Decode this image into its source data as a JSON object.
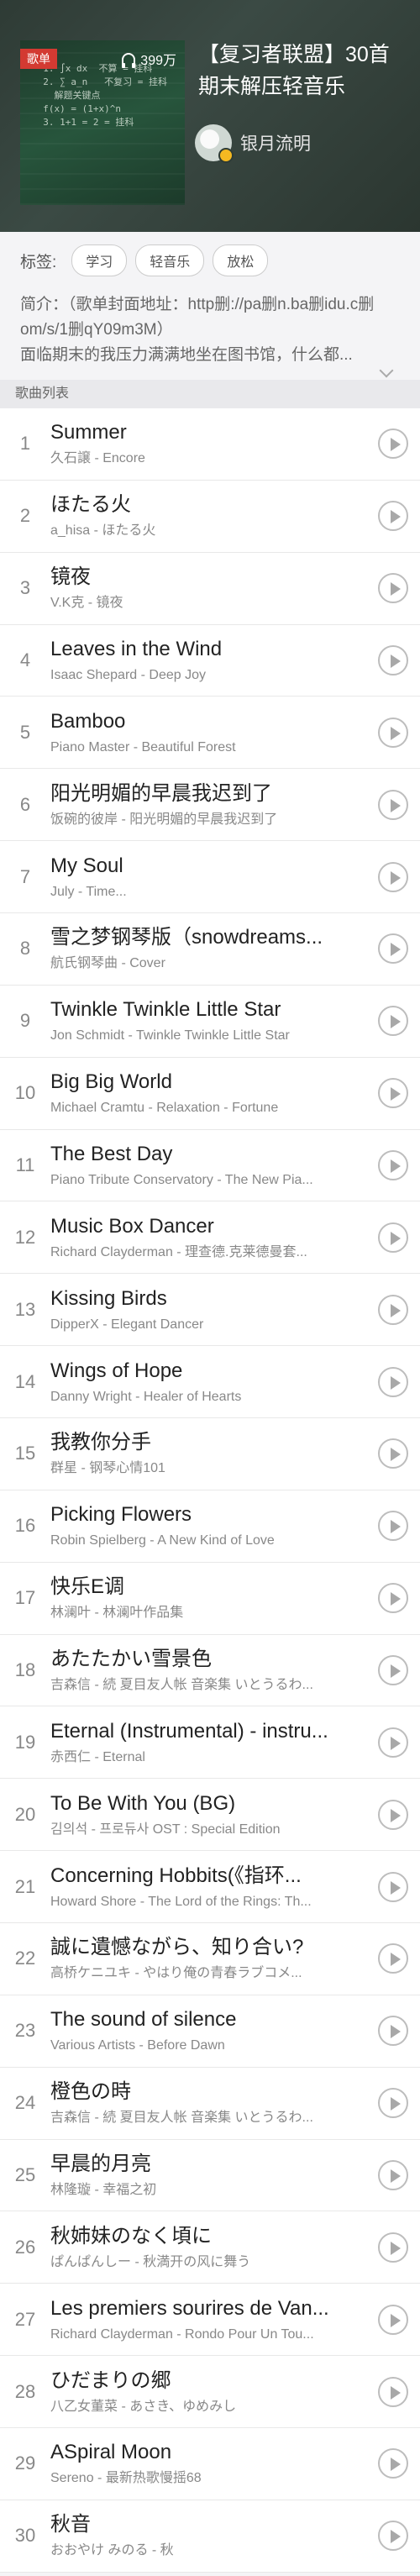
{
  "header": {
    "title": "【复习者联盟】30首期末解压轻音乐",
    "cover_tag": "歌单",
    "play_count": "399万",
    "creator_name": "银月流明"
  },
  "tags": {
    "label": "标签:",
    "items": [
      "学习",
      "轻音乐",
      "放松"
    ]
  },
  "description": {
    "line1": "简介：（歌单封面地址：http删://pa删n.ba删idu.c删om/s/1删qY09m3M）",
    "line2": "面临期末的我压力满满地坐在图书馆，什么都..."
  },
  "list_header": "歌曲列表",
  "songs": [
    {
      "index": "1",
      "name": "Summer",
      "sub": "久石譲 - Encore"
    },
    {
      "index": "2",
      "name": "ほたる火",
      "sub": "a_hisa - ほたる火"
    },
    {
      "index": "3",
      "name": "镜夜",
      "sub": "V.K克 - 镜夜"
    },
    {
      "index": "4",
      "name": "Leaves in the Wind",
      "sub": "Isaac Shepard - Deep Joy"
    },
    {
      "index": "5",
      "name": "Bamboo",
      "sub": "Piano Master - Beautiful Forest"
    },
    {
      "index": "6",
      "name": "阳光明媚的早晨我迟到了",
      "sub": "饭碗的彼岸 - 阳光明媚的早晨我迟到了"
    },
    {
      "index": "7",
      "name": "My Soul",
      "sub": "July - Time..."
    },
    {
      "index": "8",
      "name": "雪之梦钢琴版（snowdreams...",
      "sub": "航氏钢琴曲 - Cover"
    },
    {
      "index": "9",
      "name": "Twinkle Twinkle Little Star",
      "sub": "Jon Schmidt - Twinkle Twinkle Little Star"
    },
    {
      "index": "10",
      "name": "Big Big World",
      "sub": "Michael Cramtu - Relaxation - Fortune"
    },
    {
      "index": "11",
      "name": "The Best Day",
      "sub": "Piano Tribute Conservatory - The New Pia..."
    },
    {
      "index": "12",
      "name": "Music Box Dancer",
      "sub": "Richard Clayderman - 理查德.克莱德曼套..."
    },
    {
      "index": "13",
      "name": "Kissing Birds",
      "sub": "DipperX - Elegant Dancer"
    },
    {
      "index": "14",
      "name": "Wings of Hope",
      "sub": "Danny Wright - Healer of Hearts"
    },
    {
      "index": "15",
      "name": "我教你分手",
      "sub": "群星 - 钢琴心情101"
    },
    {
      "index": "16",
      "name": "Picking Flowers",
      "sub": "Robin Spielberg - A New Kind of Love"
    },
    {
      "index": "17",
      "name": "快乐E调",
      "sub": "林澜叶 - 林澜叶作品集"
    },
    {
      "index": "18",
      "name": "あたたかい雪景色",
      "sub": "吉森信 - 続 夏目友人帐 音楽集 いとうるわ..."
    },
    {
      "index": "19",
      "name": "Eternal (Instrumental) - instru...",
      "sub": "赤西仁 - Eternal"
    },
    {
      "index": "20",
      "name": "To Be With You (BG)",
      "sub": "김의석 - 프로듀사 OST : Special Edition"
    },
    {
      "index": "21",
      "name": "Concerning Hobbits(《指环...",
      "sub": "Howard Shore - The Lord of the Rings: Th..."
    },
    {
      "index": "22",
      "name": "誠に遺憾ながら、知り合い?",
      "sub": "高桥ケニユキ - やはり俺の青春ラブコメ..."
    },
    {
      "index": "23",
      "name": "The sound of silence",
      "sub": "Various Artists - Before Dawn"
    },
    {
      "index": "24",
      "name": "橙色の時",
      "sub": "吉森信 - 続 夏目友人帐 音楽集 いとうるわ..."
    },
    {
      "index": "25",
      "name": "早晨的月亮",
      "sub": "林隆璇 - 幸福之初"
    },
    {
      "index": "26",
      "name": "秋姉妹のなく頃に",
      "sub": "ぱんぱんしー - 秋満开の风に舞う"
    },
    {
      "index": "27",
      "name": "Les premiers sourires de Van...",
      "sub": "Richard Clayderman - Rondo Pour Un Tou..."
    },
    {
      "index": "28",
      "name": "ひだまりの郷",
      "sub": "八乙女董菜 - あさき、ゆめみし"
    },
    {
      "index": "29",
      "name": "ASpiral Moon",
      "sub": "Sereno - 最新热歌慢摇68"
    },
    {
      "index": "30",
      "name": "秋音",
      "sub": "おおやけ みのる - 秋"
    }
  ],
  "icons": {
    "play": "play-circle-icon",
    "headphone": "headphone-icon",
    "expand": "chevron-down-icon"
  },
  "colors": {
    "header_bg": "#2e3b35",
    "tag_red": "#d33a32",
    "badge_gold": "#f5b921"
  }
}
